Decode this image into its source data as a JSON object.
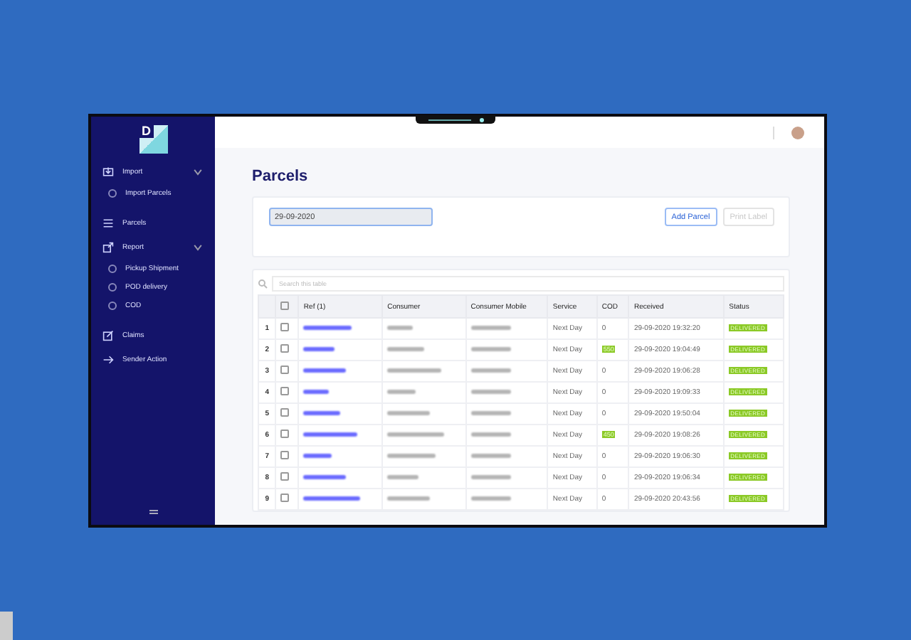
{
  "logo": {
    "letter": "D"
  },
  "sidebar": {
    "items": [
      {
        "kind": "section",
        "label": "Import",
        "expanded": true
      },
      {
        "kind": "sub",
        "label": "Import Parcels"
      },
      {
        "kind": "link",
        "label": "Parcels"
      },
      {
        "kind": "section",
        "label": "Report",
        "expanded": true
      },
      {
        "kind": "sub",
        "label": "Pickup Shipment"
      },
      {
        "kind": "sub",
        "label": "POD delivery"
      },
      {
        "kind": "sub",
        "label": "COD"
      },
      {
        "kind": "link",
        "label": "Claims"
      },
      {
        "kind": "link",
        "label": "Sender Action"
      }
    ]
  },
  "page": {
    "title": "Parcels"
  },
  "filter": {
    "date": "29-09-2020",
    "buttons": [
      {
        "label": "Add Parcel",
        "disabled": false
      },
      {
        "label": "Print Label",
        "disabled": true
      }
    ]
  },
  "table": {
    "search_placeholder": "Search this table",
    "all_checked": false,
    "columns": [
      "Ref (1)",
      "Consumer",
      "Consumer Mobile",
      "Service",
      "COD",
      "Received",
      "Status"
    ],
    "rows": [
      {
        "index": "1",
        "checked": false,
        "service": "Next Day",
        "cod": "0",
        "cod_highlighted": false,
        "received": "29-09-2020 19:32:20",
        "status": "DELIVERED"
      },
      {
        "index": "2",
        "checked": false,
        "service": "Next Day",
        "cod": "550",
        "cod_highlighted": true,
        "received": "29-09-2020 19:04:49",
        "status": "DELIVERED"
      },
      {
        "index": "3",
        "checked": false,
        "service": "Next Day",
        "cod": "0",
        "cod_highlighted": false,
        "received": "29-09-2020 19:06:28",
        "status": "DELIVERED"
      },
      {
        "index": "4",
        "checked": false,
        "service": "Next Day",
        "cod": "0",
        "cod_highlighted": false,
        "received": "29-09-2020 19:09:33",
        "status": "DELIVERED"
      },
      {
        "index": "5",
        "checked": false,
        "service": "Next Day",
        "cod": "0",
        "cod_highlighted": false,
        "received": "29-09-2020 19:50:04",
        "status": "DELIVERED"
      },
      {
        "index": "6",
        "checked": false,
        "service": "Next Day",
        "cod": "450",
        "cod_highlighted": true,
        "received": "29-09-2020 19:08:26",
        "status": "DELIVERED"
      },
      {
        "index": "7",
        "checked": false,
        "service": "Next Day",
        "cod": "0",
        "cod_highlighted": false,
        "received": "29-09-2020 19:06:30",
        "status": "DELIVERED"
      },
      {
        "index": "8",
        "checked": false,
        "service": "Next Day",
        "cod": "0",
        "cod_highlighted": false,
        "received": "29-09-2020 19:06:34",
        "status": "DELIVERED"
      },
      {
        "index": "9",
        "checked": false,
        "service": "Next Day",
        "cod": "0",
        "cod_highlighted": false,
        "received": "29-09-2020 20:43:56",
        "status": "DELIVERED"
      }
    ]
  }
}
